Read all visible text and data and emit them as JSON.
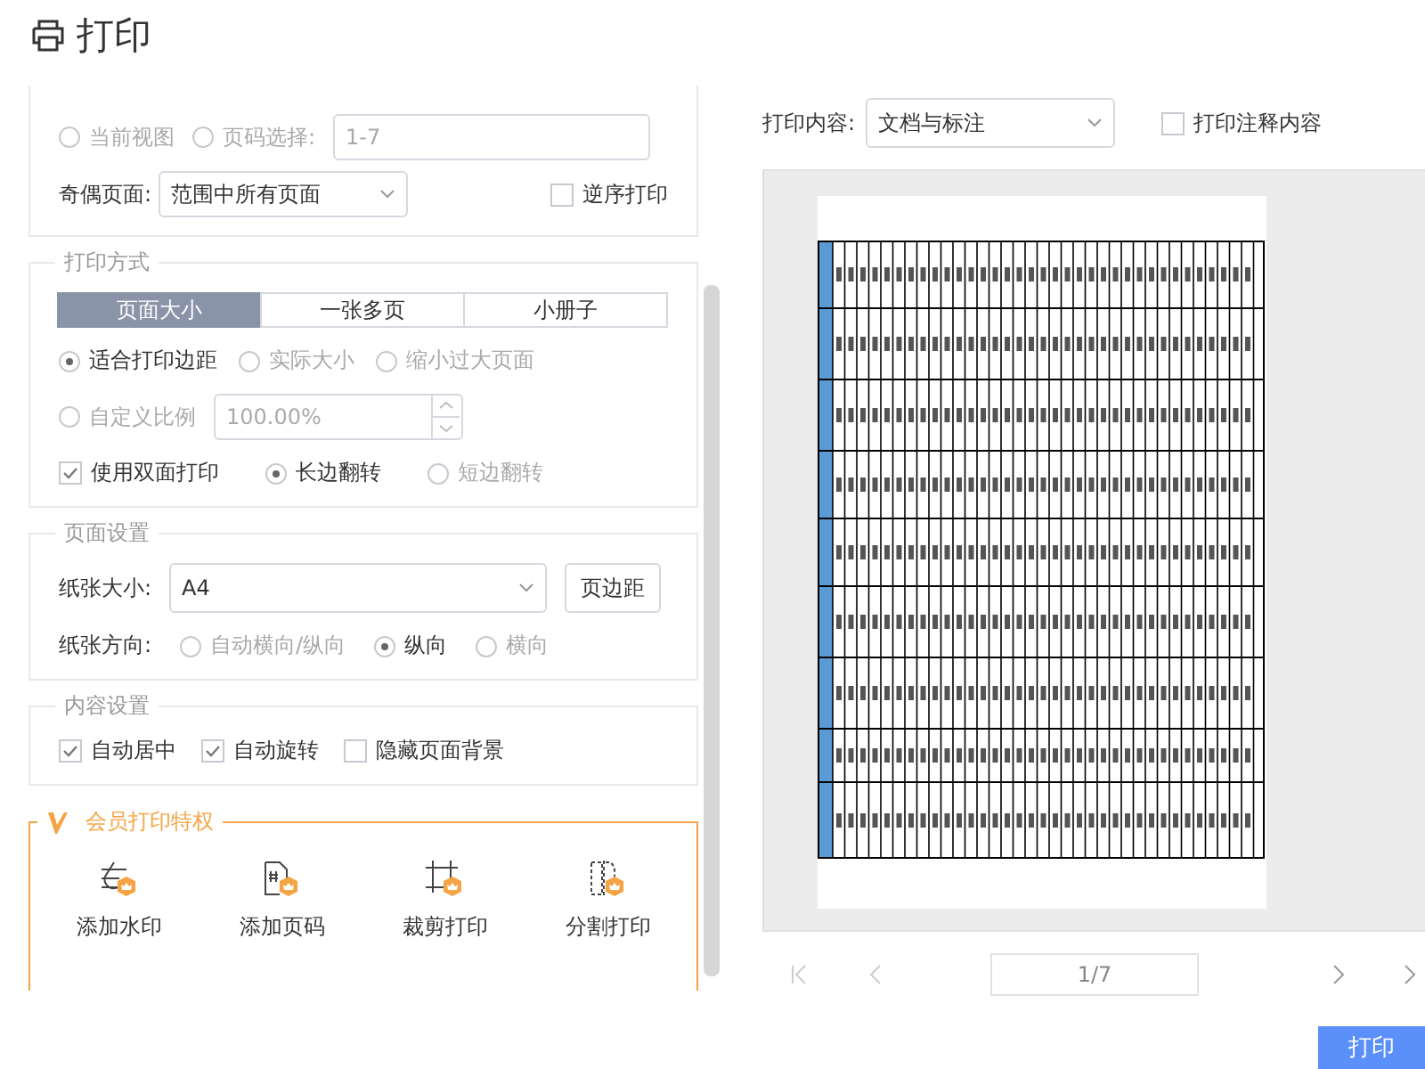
{
  "title": "打印",
  "range": {
    "options": [
      {
        "label": "当前视图",
        "selected": false,
        "disabled": true
      },
      {
        "label": "页码选择:",
        "selected": false,
        "disabled": true
      }
    ],
    "page_input": "1-7",
    "odd_even_label": "奇偶页面:",
    "odd_even_value": "范围中所有页面",
    "reverse": {
      "label": "逆序打印",
      "checked": false
    }
  },
  "print_mode": {
    "title": "打印方式",
    "tabs": [
      {
        "label": "页面大小",
        "selected": true
      },
      {
        "label": "一张多页",
        "selected": false
      },
      {
        "label": "小册子",
        "selected": false
      }
    ],
    "scale_options": [
      {
        "label": "适合打印边距",
        "selected": true,
        "disabled": false
      },
      {
        "label": "实际大小",
        "selected": false,
        "disabled": true
      },
      {
        "label": "缩小过大页面",
        "selected": false,
        "disabled": true
      }
    ],
    "custom_scale": {
      "label": "自定义比例",
      "selected": false,
      "disabled": true,
      "value": "100.00%"
    },
    "duplex": {
      "label": "使用双面打印",
      "checked": true
    },
    "flip_options": [
      {
        "label": "长边翻转",
        "selected": true,
        "disabled": false
      },
      {
        "label": "短边翻转",
        "selected": false,
        "disabled": true
      }
    ]
  },
  "page_setup": {
    "title": "页面设置",
    "paper_label": "纸张大小:",
    "paper_value": "A4",
    "margins_button": "页边距",
    "orientation_label": "纸张方向:",
    "orientations": [
      {
        "label": "自动横向/纵向",
        "selected": false,
        "disabled": true
      },
      {
        "label": "纵向",
        "selected": true,
        "disabled": false
      },
      {
        "label": "横向",
        "selected": false,
        "disabled": true
      }
    ]
  },
  "content_setup": {
    "title": "内容设置",
    "options": [
      {
        "label": "自动居中",
        "checked": true
      },
      {
        "label": "自动旋转",
        "checked": true
      },
      {
        "label": "隐藏页面背景",
        "checked": false
      }
    ]
  },
  "vip": {
    "title": "会员打印特权",
    "tools": [
      {
        "kind": "watermark",
        "label": "添加水印"
      },
      {
        "kind": "page_number",
        "label": "添加页码"
      },
      {
        "kind": "crop",
        "label": "裁剪打印"
      },
      {
        "kind": "split",
        "label": "分割打印"
      }
    ]
  },
  "preview": {
    "content_label": "打印内容:",
    "content_value": "文档与标注",
    "annotations": {
      "label": "打印注释内容",
      "checked": false
    },
    "page_field": "1/7"
  },
  "print_button": "打印"
}
